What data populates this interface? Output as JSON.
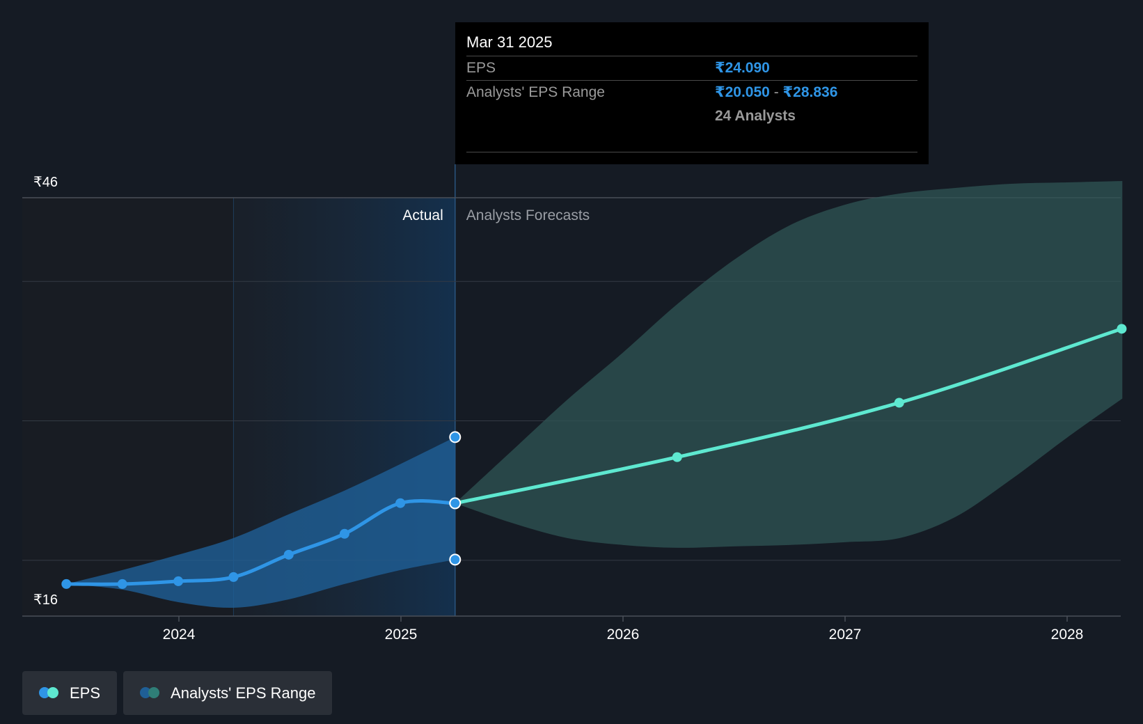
{
  "chart_data": {
    "type": "line",
    "y_axis": {
      "min_label": "₹16",
      "max_label": "₹46",
      "ylim": [
        16,
        46
      ],
      "gridlines": [
        40,
        30,
        20
      ]
    },
    "x_axis": {
      "ticks": [
        "2024",
        "2025",
        "2026",
        "2027",
        "2028"
      ],
      "tick_values": [
        2024,
        2025,
        2026,
        2027,
        2028
      ]
    },
    "region_labels": {
      "actual": "Actual",
      "forecast": "Analysts Forecasts"
    },
    "series": [
      {
        "name": "EPS",
        "segment": "actual",
        "color": "#2f95e6",
        "points": [
          {
            "date": "2023-06-30",
            "value": 18.3
          },
          {
            "date": "2023-09-30",
            "value": 18.3
          },
          {
            "date": "2023-12-31",
            "value": 18.5
          },
          {
            "date": "2024-03-31",
            "value": 18.8
          },
          {
            "date": "2024-06-30",
            "value": 20.4
          },
          {
            "date": "2024-09-30",
            "value": 21.9
          },
          {
            "date": "2024-12-31",
            "value": 24.1
          },
          {
            "date": "2025-03-31",
            "value": 24.09
          }
        ]
      },
      {
        "name": "EPS",
        "segment": "forecast",
        "color": "#5ee8d0",
        "points": [
          {
            "date": "2025-03-31",
            "value": 24.09
          },
          {
            "date": "2026-03-31",
            "value": 27.4
          },
          {
            "date": "2027-03-31",
            "value": 31.3
          },
          {
            "date": "2028-03-31",
            "value": 36.6
          }
        ]
      }
    ],
    "range": {
      "name": "Analysts' EPS Range",
      "actual_color": "#1f5f96",
      "forecast_color": "#2f5654",
      "actual_points": [
        {
          "date": "2023-06-30",
          "low": 18.3,
          "high": 18.3
        },
        {
          "date": "2023-09-30",
          "low": 17.9,
          "high": 19.3
        },
        {
          "date": "2023-12-31",
          "low": 17.0,
          "high": 20.4
        },
        {
          "date": "2024-03-31",
          "low": 16.6,
          "high": 21.6
        },
        {
          "date": "2024-06-30",
          "low": 17.2,
          "high": 23.3
        },
        {
          "date": "2024-09-30",
          "low": 18.3,
          "high": 25.0
        },
        {
          "date": "2024-12-31",
          "low": 19.3,
          "high": 26.9
        },
        {
          "date": "2025-03-31",
          "low": 20.05,
          "high": 28.836
        }
      ],
      "forecast_points": [
        {
          "date": "2025-03-31",
          "low": 24.09,
          "high": 24.09
        },
        {
          "date": "2025-07-01",
          "low": 22.7,
          "high": 27.8
        },
        {
          "date": "2025-10-01",
          "low": 21.6,
          "high": 31.5
        },
        {
          "date": "2026-01-01",
          "low": 21.1,
          "high": 34.9
        },
        {
          "date": "2026-04-01",
          "low": 20.9,
          "high": 38.4
        },
        {
          "date": "2026-07-01",
          "low": 21.0,
          "high": 41.5
        },
        {
          "date": "2026-10-01",
          "low": 21.1,
          "high": 44.0
        },
        {
          "date": "2027-01-01",
          "low": 21.3,
          "high": 45.5
        },
        {
          "date": "2027-04-01",
          "low": 21.6,
          "high": 46.3
        },
        {
          "date": "2027-07-01",
          "low": 23.1,
          "high": 46.7
        },
        {
          "date": "2027-10-01",
          "low": 25.8,
          "high": 47.0
        },
        {
          "date": "2028-01-01",
          "low": 28.8,
          "high": 47.1
        },
        {
          "date": "2028-04-01",
          "low": 31.6,
          "high": 47.2
        }
      ],
      "highlight_markers": [
        {
          "date": "2025-03-31",
          "value": 28.836
        },
        {
          "date": "2025-03-31",
          "value": 24.09
        },
        {
          "date": "2025-03-31",
          "value": 20.05
        }
      ]
    },
    "grid": true,
    "legend_position": "bottom-left"
  },
  "tooltip": {
    "date": "Mar 31 2025",
    "eps_label": "EPS",
    "eps_value": "₹24.090",
    "range_label": "Analysts' EPS Range",
    "range_low": "₹20.050",
    "range_sep": "-",
    "range_high": "₹28.836",
    "analysts": "24 Analysts"
  },
  "legend": [
    {
      "label": "EPS",
      "colors": [
        "#2f95e6",
        "#5ee8d0"
      ]
    },
    {
      "label": "Analysts' EPS Range",
      "colors": [
        "#1f5f96",
        "#2f7e77"
      ]
    }
  ]
}
